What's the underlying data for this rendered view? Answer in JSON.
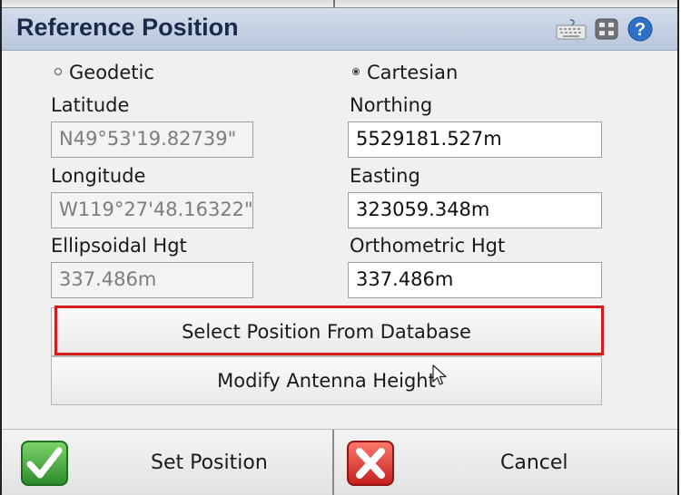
{
  "window": {
    "title": "Reference Position"
  },
  "toolbar": {
    "icons": [
      "keyboard-icon",
      "grid-icon",
      "help-icon"
    ]
  },
  "coordinate_mode": {
    "options": [
      "Geodetic",
      "Cartesian"
    ],
    "selected": "Cartesian"
  },
  "geodetic": {
    "latitude_label": "Latitude",
    "latitude_value": "N49°53'19.82739\"",
    "longitude_label": "Longitude",
    "longitude_value": "W119°27'48.16322\"",
    "ellipsoidal_label": "Ellipsoidal Hgt",
    "ellipsoidal_value": "337.486m"
  },
  "cartesian": {
    "northing_label": "Northing",
    "northing_value": "5529181.527m",
    "easting_label": "Easting",
    "easting_value": "323059.348m",
    "orthometric_label": "Orthometric Hgt",
    "orthometric_value": "337.486m"
  },
  "actions": {
    "select_position": "Select Position From Database",
    "modify_antenna": "Modify Antenna Height"
  },
  "footer": {
    "set_position": "Set Position",
    "cancel": "Cancel"
  },
  "colors": {
    "titlebar": "#c4d0e3",
    "highlight": "#d41e1e",
    "check_green": "#2f9a2f",
    "cancel_red": "#d02a2a"
  }
}
